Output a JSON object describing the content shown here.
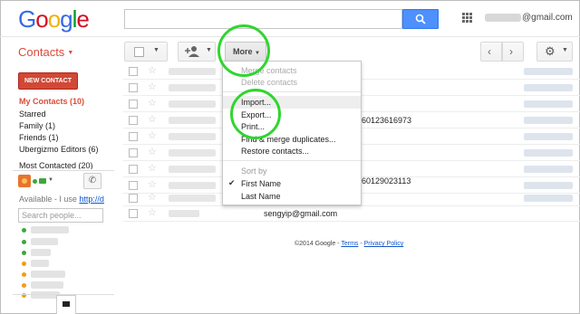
{
  "header": {
    "logo": [
      "G",
      "o",
      "o",
      "g",
      "l",
      "e"
    ],
    "logo_colors": [
      "#3369e8",
      "#d50f25",
      "#eeb211",
      "#3369e8",
      "#009925",
      "#d50f25"
    ],
    "account_email": "@gmail.com"
  },
  "app": {
    "title": "Contacts"
  },
  "toolbar": {
    "more_label": "More"
  },
  "sidebar": {
    "new_contact": "NEW CONTACT",
    "items": [
      {
        "label": "My Contacts (10)"
      },
      {
        "label": "Starred"
      },
      {
        "label": "Family (1)"
      },
      {
        "label": "Friends (1)"
      },
      {
        "label": "Ubergizmo Editors (6)"
      },
      {
        "label": "Most Contacted (20)"
      }
    ]
  },
  "chat": {
    "availability_text": "Available - I use ",
    "availability_link": "http://d",
    "search_placeholder": "Search people..."
  },
  "contacts": {
    "rows": [
      {
        "phone": "",
        "email": ""
      },
      {
        "phone": "",
        "email": ""
      },
      {
        "phone": "",
        "email": ""
      },
      {
        "phone": "60123616973",
        "email": ""
      },
      {
        "phone": "",
        "email": ""
      },
      {
        "phone": "",
        "email": ""
      },
      {
        "phone": "",
        "email": ""
      },
      {
        "phone": "",
        "email": ""
      },
      {
        "phone": "60129023113",
        "email": ""
      },
      {
        "phone": "",
        "email": ""
      },
      {
        "phone": "sengyip@gmail.com",
        "email": ""
      }
    ]
  },
  "footer": {
    "copyright": "©2014 Google - ",
    "terms": "Terms",
    "sep": " - ",
    "privacy": "Privacy Policy"
  },
  "menu": {
    "merge_contacts": "Merge contacts",
    "delete_contacts": "Delete contacts",
    "import": "Import...",
    "export": "Export...",
    "print": "Print...",
    "find_merge": "Find & merge duplicates...",
    "restore": "Restore contacts...",
    "sort_by": "Sort by",
    "first_name": "First Name",
    "last_name": "Last Name"
  },
  "colors": {
    "accent_red": "#dd4b39",
    "search_blue": "#4d90fe",
    "highlight_ring": "#2fd62f"
  }
}
